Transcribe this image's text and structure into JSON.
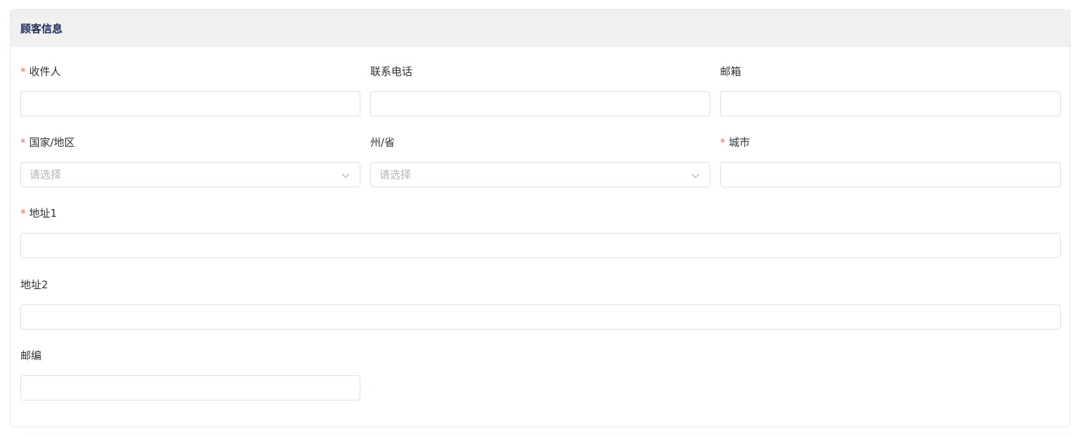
{
  "section": {
    "title": "顾客信息"
  },
  "fields": {
    "recipient": {
      "label": "收件人",
      "required": "*",
      "value": ""
    },
    "phone": {
      "label": "联系电话",
      "value": ""
    },
    "email": {
      "label": "邮箱",
      "value": ""
    },
    "country": {
      "label": "国家/地区",
      "required": "*",
      "placeholder": "请选择"
    },
    "state": {
      "label": "州/省",
      "placeholder": "请选择"
    },
    "city": {
      "label": "城市",
      "required": "*",
      "value": ""
    },
    "address1": {
      "label": "地址1",
      "required": "*",
      "value": ""
    },
    "address2": {
      "label": "地址2",
      "value": ""
    },
    "zip": {
      "label": "邮编",
      "value": ""
    }
  },
  "icons": {
    "select_arrow": "chevron-down-icon"
  },
  "colors": {
    "required_mark": "#f56c6c",
    "header_bg": "#f0f0f0",
    "title": "#1d2b5a",
    "border": "#dcdfe6",
    "placeholder": "#b0b3b8"
  }
}
